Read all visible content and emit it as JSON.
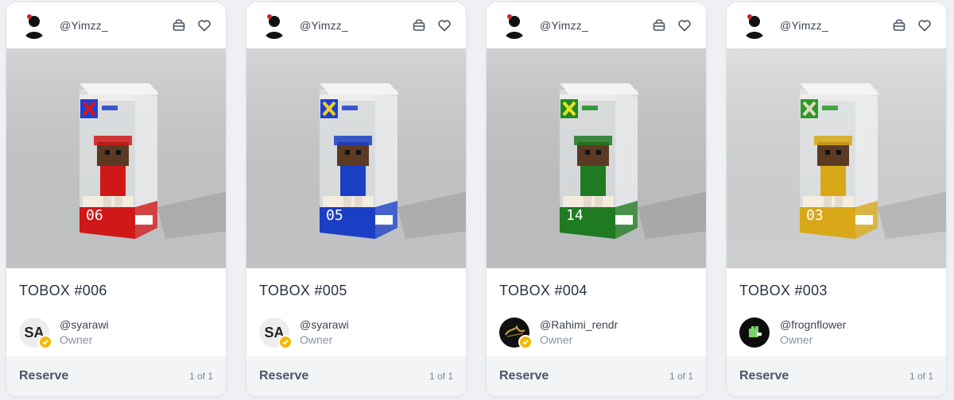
{
  "cards": [
    {
      "creator": "@Yimzz_",
      "title": "TOBOX #006",
      "owner": {
        "handle": "@syarawi",
        "role": "Owner",
        "avatar_initials": "SA",
        "verified": true
      },
      "action_label": "Reserve",
      "edition": "1 of 1",
      "box_number": "06",
      "accent_color": "#d01818",
      "logo_color": "#1f3fd0",
      "x_color": "#d01818",
      "bg_color": "#c9cacc"
    },
    {
      "creator": "@Yimzz_",
      "title": "TOBOX #005",
      "owner": {
        "handle": "@syarawi",
        "role": "Owner",
        "avatar_initials": "SA",
        "verified": true
      },
      "action_label": "Reserve",
      "edition": "1 of 1",
      "box_number": "05",
      "accent_color": "#1b3fc4",
      "logo_color": "#1f3fd0",
      "x_color": "#f0d020",
      "bg_color": "#cacbcd"
    },
    {
      "creator": "@Yimzz_",
      "title": "TOBOX #004",
      "owner": {
        "handle": "@Rahimi_rendr",
        "role": "Owner",
        "avatar_initials": "",
        "verified": true
      },
      "action_label": "Reserve",
      "edition": "1 of 1",
      "box_number": "14",
      "accent_color": "#1f7a22",
      "logo_color": "#1f8a22",
      "x_color": "#e8e020",
      "bg_color": "#c4c5c7"
    },
    {
      "creator": "@Yimzz_",
      "title": "TOBOX #003",
      "owner": {
        "handle": "@frognflower",
        "role": "Owner",
        "avatar_initials": "",
        "verified": false
      },
      "action_label": "Reserve",
      "edition": "1 of 1",
      "box_number": "03",
      "accent_color": "#d8a818",
      "logo_color": "#2a9a2a",
      "x_color": "#e0d8c0",
      "bg_color": "#d6d7d8"
    }
  ],
  "icons": {
    "header_left": "bag-icon",
    "header_right": "heart-icon",
    "verified": "check-badge-icon"
  }
}
